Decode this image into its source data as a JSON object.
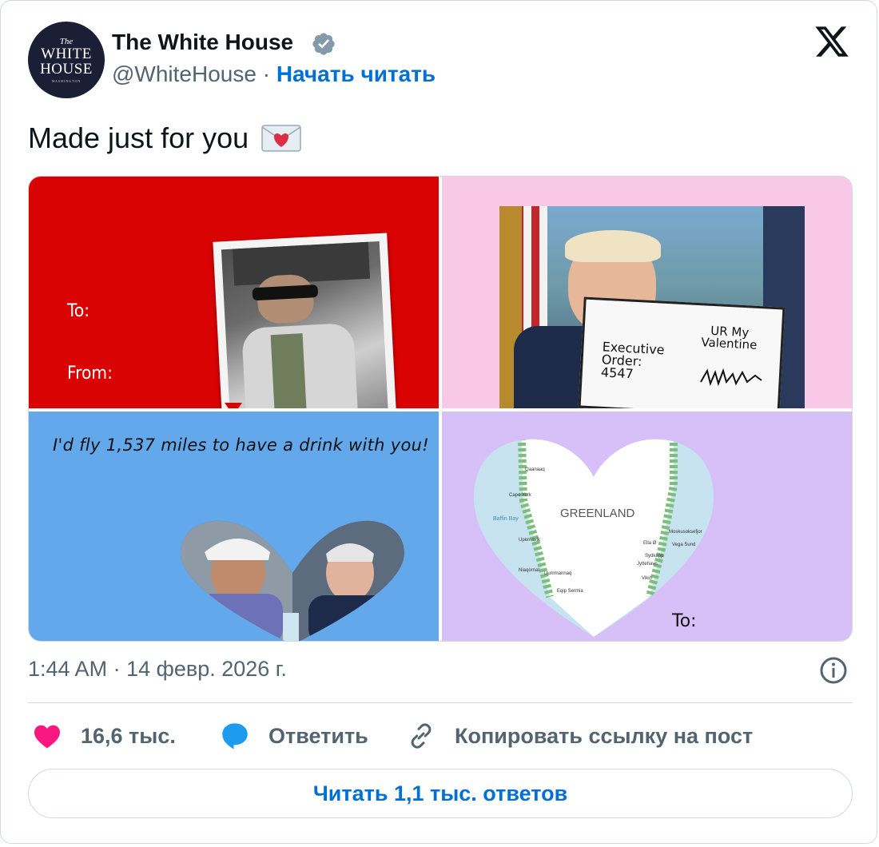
{
  "account": {
    "name": "The White House",
    "handle": "@WhiteHouse",
    "separator": "·",
    "follow_label": "Начать читать",
    "avatar": {
      "the": "The",
      "line1": "WHITE",
      "line2": "HOUSE",
      "line3": "WASHINGTON"
    },
    "verified_icon": "verified-badge-icon"
  },
  "post": {
    "text": "Made just for you"
  },
  "media": {
    "card1": {
      "to_label": "To:",
      "from_label": "From:"
    },
    "card2": {
      "doc_left_line1": "Executive",
      "doc_left_line2": "Order:",
      "doc_left_line3": "4547",
      "doc_right_line1": "UR My",
      "doc_right_line2": "Valentine"
    },
    "card3": {
      "text": "I'd fly 1,537 miles to have a drink with you!"
    },
    "card4": {
      "map_title": "GREENLAND",
      "places": [
        "Qaanaaq",
        "Cape York",
        "Baffin Bay",
        "Upernavik",
        "Niaqornat",
        "Uummannaq",
        "Eqip Sermia",
        "Moskusoksefjor",
        "Ella Ø",
        "Vega Sund",
        "Sydkapp",
        "Jyttehavn",
        "Vikin"
      ],
      "to_label": "To:"
    }
  },
  "meta": {
    "time": "1:44 AM",
    "separator": "·",
    "date": "14 февр. 2026 г."
  },
  "actions": {
    "likes": "16,6 тыс.",
    "reply": "Ответить",
    "copy_link": "Копировать ссылку на пост"
  },
  "read_replies": "Читать 1,1 тыс. ответов",
  "colors": {
    "link_blue": "#006fd6",
    "like_pink": "#f91880",
    "reply_blue": "#1d9bf0",
    "card_red": "#d90304",
    "card_pink": "#f9c8e6",
    "card_blue": "#62a8eb",
    "card_purple": "#d6c0f7"
  }
}
